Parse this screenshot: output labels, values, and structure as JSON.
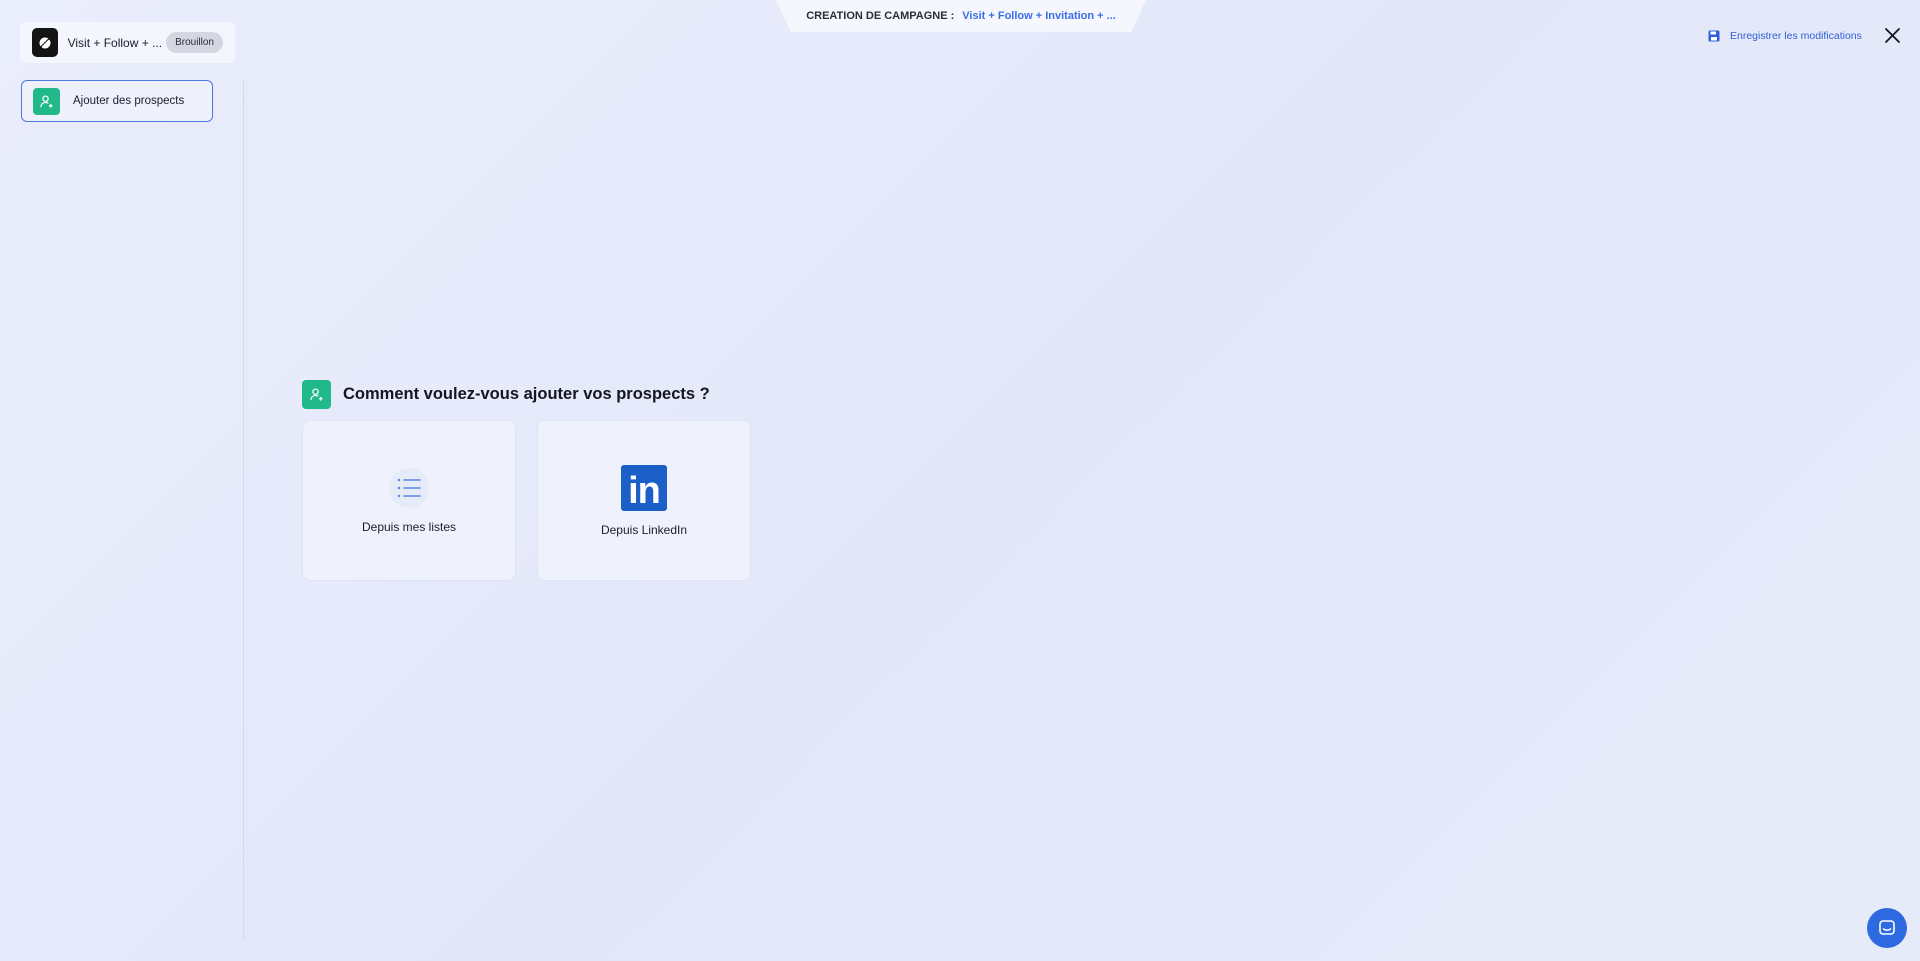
{
  "header": {
    "tab_label": "CREATION DE CAMPAGNE :",
    "tab_value": "Visit + Follow + Invitation + ...",
    "save_label": "Enregistrer les modifications",
    "close_icon": "close-icon"
  },
  "campaign": {
    "name": "Visit + Follow + ...",
    "status": "Brouillon"
  },
  "sidebar": {
    "items": [
      {
        "label": "Ajouter des prospects",
        "icon": "user-add-icon"
      }
    ]
  },
  "main": {
    "question": "Comment voulez-vous ajouter vos prospects ?",
    "options": [
      {
        "label": "Depuis mes listes",
        "icon": "list-icon"
      },
      {
        "label": "Depuis LinkedIn",
        "icon": "linkedin-icon"
      }
    ]
  },
  "colors": {
    "accent": "#2f5fd6",
    "green": "#22b98a",
    "linkedin": "#1d5fc9"
  }
}
